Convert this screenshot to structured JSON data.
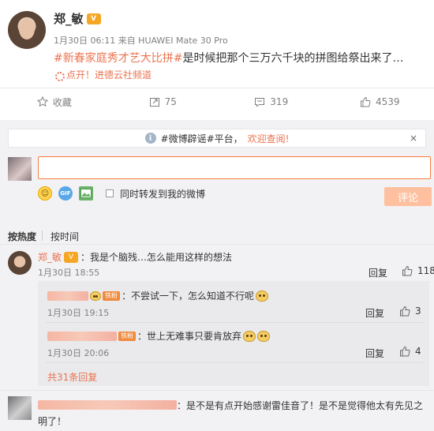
{
  "post": {
    "author": "郑_敏",
    "author_badge": "V",
    "meta": "1月30日 06:11 来自 HUAWEI Mate 30 Pro",
    "hashtag": "#新春家庭秀才艺大比拼#",
    "text": "是时候把那个三万六千块的拼图给祭出来了…",
    "location": "点开！进德云社频道"
  },
  "actions": {
    "favorite": "收藏",
    "forward": "75",
    "comments": "319",
    "likes": "4539"
  },
  "notice": {
    "prefix": "#微博辟谣#平台，",
    "link": "欢迎查阅!",
    "close": "×"
  },
  "composer": {
    "value": "",
    "placeholder": "",
    "forward_label": "同时转发到我的微博",
    "submit": "评论",
    "gif_label": "GIF"
  },
  "sort": {
    "hot": "按热度",
    "time": "按时间"
  },
  "comments": [
    {
      "author": "郑_敏",
      "text": "：我是个脑残…怎么能用这样的想法",
      "time": "1月30日 18:55",
      "reply": "回复",
      "likes": "118",
      "subs": [
        {
          "level": "铁粉",
          "text": "：不尝试一下，怎么知道不行呢",
          "time": "1月30日 19:15",
          "reply": "回复",
          "likes": "3"
        },
        {
          "level": "铁粉",
          "text": "：世上无难事只要肯放弃",
          "time": "1月30日 20:06",
          "reply": "回复",
          "likes": "4"
        }
      ],
      "more": "共31条回复"
    },
    {
      "text": "：是不是有点开始感谢雷佳音了！是不是觉得他太有先见之明了！"
    }
  ],
  "colors": {
    "accent": "#eb7350",
    "submit_bg": "#ffc09f",
    "panel_bg": "#f2f2f5"
  }
}
